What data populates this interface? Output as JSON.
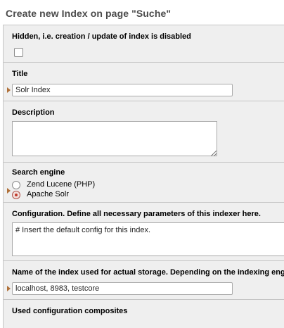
{
  "page": {
    "title": "Create new Index on page \"Suche\""
  },
  "fields": {
    "hidden": {
      "label": "Hidden, i.e. creation / update of index is disabled",
      "checked": false
    },
    "title": {
      "label": "Title",
      "value": "Solr Index"
    },
    "description": {
      "label": "Description",
      "value": ""
    },
    "search_engine": {
      "label": "Search engine",
      "options": [
        {
          "label": "Zend Lucene (PHP)",
          "selected": false
        },
        {
          "label": "Apache Solr",
          "selected": true
        }
      ]
    },
    "configuration": {
      "label": "Configuration. Define all necessary parameters of this indexer here.",
      "value": "# Insert the default config for this index."
    },
    "storage": {
      "label": "Name of the index used for actual storage. Depending on the indexing engine",
      "value": "localhost, 8983, testcore"
    },
    "composites": {
      "label": "Used configuration composites"
    }
  },
  "colors": {
    "section_bg": "#efefef",
    "border": "#c5c5c5",
    "marker": "#b0713a",
    "radio_selected": "#c0392b",
    "title_text": "#4a4a4a"
  }
}
